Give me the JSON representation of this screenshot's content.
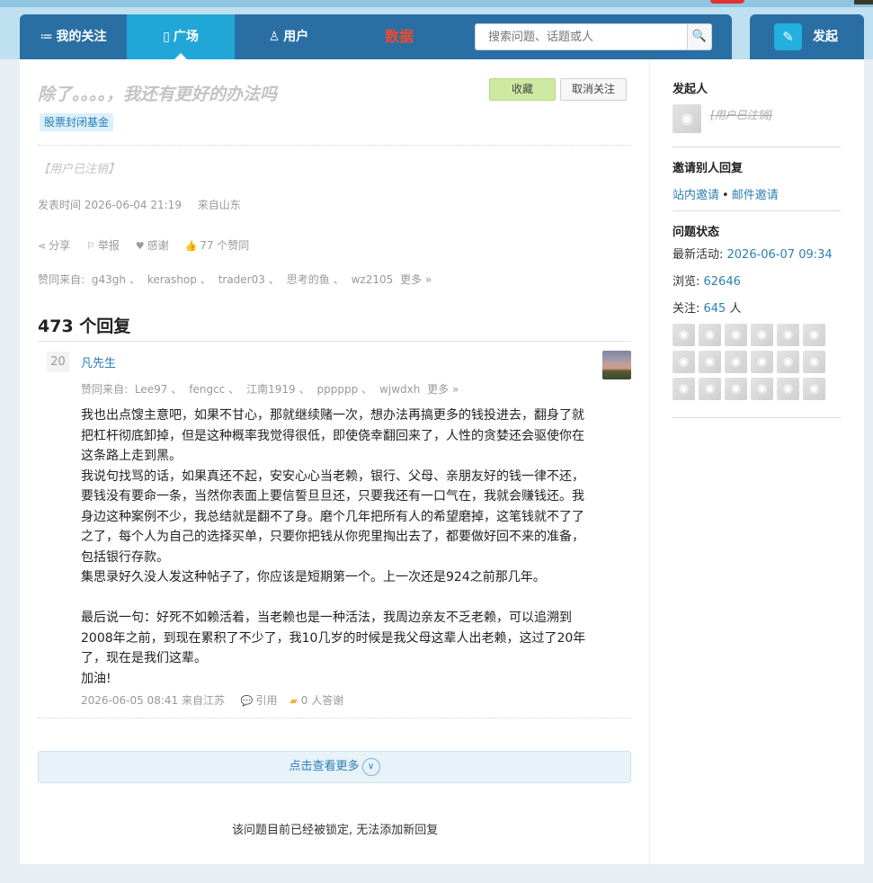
{
  "nav": {
    "items": [
      {
        "icon": "≔",
        "label": "我的关注"
      },
      {
        "icon": "▯",
        "label": "广场"
      },
      {
        "icon": "♙",
        "label": "用户"
      },
      {
        "icon": "",
        "label": "数据"
      }
    ],
    "search_placeholder": "搜索问题、话题或人",
    "search_icon": "🔍",
    "launch_icon": "✎",
    "launch_label": "发起"
  },
  "question": {
    "title": "除了。。。。，我还有更好的办法吗",
    "fav_label": "收藏",
    "unfollow_label": "取消关注",
    "tag": "股票封闭基金",
    "author": "【用户已注销】",
    "post_time": "发表时间 2026-06-04 21:19",
    "location": "来自山东",
    "actions": {
      "share": "分享",
      "report": "举报",
      "thanks": "感谢",
      "likes": "77 个赞同"
    },
    "likers_label": "赞同来自:",
    "likers": [
      "g43gh",
      "kerashop",
      "trader03",
      "思考的鱼",
      "wz2105"
    ],
    "more_label": "更多 »"
  },
  "answers": {
    "count_title": "473 个回复",
    "items": [
      {
        "votes": "20",
        "author": "凡先生",
        "likers_label": "赞同来自:",
        "likers": [
          "Lee97",
          "fengcc",
          "江南1919",
          "pppppp",
          "wjwdxh"
        ],
        "more_label": "更多 »",
        "paragraphs": [
          "我也出点馊主意吧，如果不甘心，那就继续赌一次，想办法再搞更多的钱投进去，翻身了就把杠杆彻底卸掉，但是这种概率我觉得很低，即使侥幸翻回来了，人性的贪婪还会驱使你在这条路上走到黑。",
          "我说句找骂的话，如果真还不起，安安心心当老赖，银行、父母、亲朋友好的钱一律不还，要钱没有要命一条，当然你表面上要信誓旦旦还，只要我还有一口气在，我就会赚钱还。我身边这种案例不少，我总结就是翻不了身。磨个几年把所有人的希望磨掉，这笔钱就不了了之了，每个人为自己的选择买单，只要你把钱从你兜里掏出去了，都要做好回不来的准备，包括银行存款。",
          "集思录好久没人发这种帖子了，你应该是短期第一个。上一次还是924之前那几年。",
          "",
          "最后说一句：好死不如赖活着，当老赖也是一种活法，我周边亲友不乏老赖，可以追溯到2008年之前，到现在累积了不少了，我10几岁的时候是我父母这辈人出老赖，这过了20年了，现在是我们这辈。",
          "加油!"
        ],
        "time_location": "2026-06-05 08:41 来自江苏",
        "quote_label": "引用",
        "thanks_label": "0 人答谢"
      }
    ],
    "load_more": "点击查看更多",
    "locked_notice": "该问题目前已经被锁定, 无法添加新回复"
  },
  "sidebar": {
    "starter_title": "发起人",
    "starter_name": "[用户已注销]",
    "invite_title": "邀请别人回复",
    "invite_site": "站内邀请",
    "invite_dot": "•",
    "invite_mail": "邮件邀请",
    "status_title": "问题状态",
    "latest_label": "最新活动: ",
    "latest_value": "2026-06-07 09:34",
    "views_label": "浏览: ",
    "views_value": "62646",
    "follow_label": "关注: ",
    "follow_value": "645",
    "follow_unit": " 人",
    "follower_count_shown": 18
  },
  "colors": {
    "nav_bg": "#2a6fa3",
    "nav_active": "#21a7d7",
    "data_label": "#f0492f",
    "link": "#2b7fb5",
    "fav_button": "#cde9a2"
  }
}
